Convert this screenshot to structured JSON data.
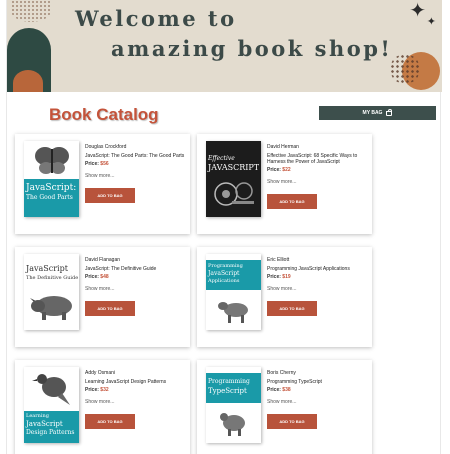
{
  "banner": {
    "line1": "Welcome to",
    "line2": "amazing book shop!"
  },
  "catalog": {
    "title": "Book Catalog",
    "my_bag_label": "MY BAG"
  },
  "labels": {
    "price": "Price:",
    "show_more": "Show more...",
    "add_to_bag": "ADD TO BAG"
  },
  "books": [
    {
      "author": "Douglas Crockford",
      "title": "JavaScript: The Good Parts: The Good Parts",
      "price": "$56",
      "cover_text": [
        "JavaScript:",
        "The Good Parts"
      ]
    },
    {
      "author": "David Herman",
      "title": "Effective JavaScript: 68 Specific Ways to Harness the Power of JavaScript",
      "price": "$22",
      "cover_text": [
        "Effective",
        "JAVASCRIPT"
      ]
    },
    {
      "author": "David Flanagan",
      "title": "JavaScript: The Definitive Guide",
      "price": "$48",
      "cover_text": [
        "JavaScript",
        "The Definitive Guide"
      ]
    },
    {
      "author": "Eric Elliott",
      "title": "Programming JavaScript Applications",
      "price": "$19",
      "cover_text": [
        "Programming",
        "JavaScript",
        "Applications"
      ]
    },
    {
      "author": "Addy Osmani",
      "title": "Learning JavaScript Design Patterns",
      "price": "$32",
      "cover_text": [
        "Learning",
        "JavaScript",
        "Design Patterns"
      ]
    },
    {
      "author": "Boris Cherny",
      "title": "Programming TypeScript",
      "price": "$38",
      "cover_text": [
        "Programming",
        "TypeScript"
      ]
    }
  ],
  "colors": {
    "accent": "#c4533a",
    "button": "#b8533b",
    "dark_button": "#3d4f4c",
    "banner_bg": "#e3dccf"
  }
}
